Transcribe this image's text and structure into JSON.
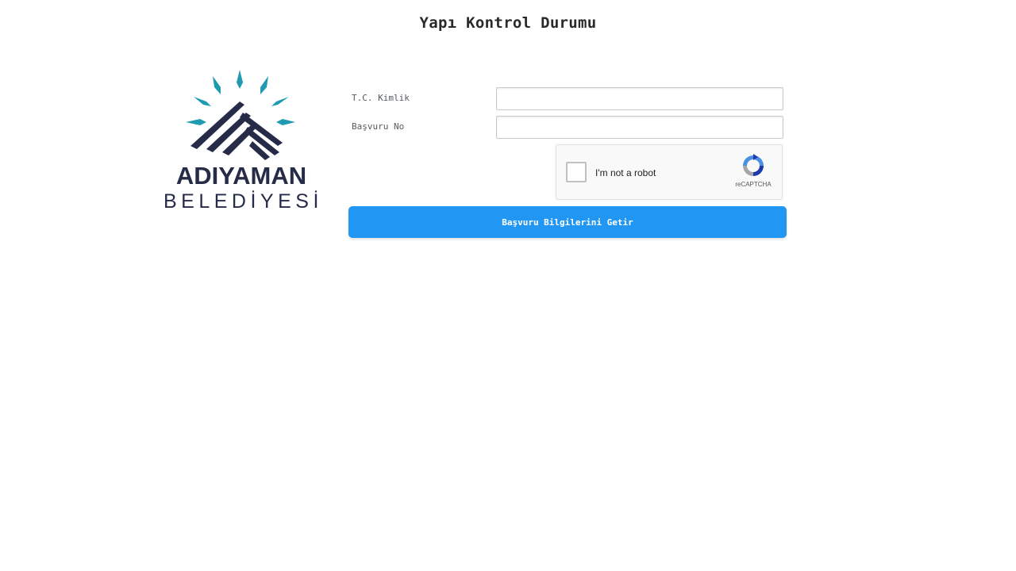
{
  "page": {
    "title": "Yapı Kontrol Durumu"
  },
  "logo": {
    "name": "ADIYAMAN",
    "sub": "BELEDİYESİ",
    "icon": "adiyaman-municipality-logo",
    "colors": {
      "navy": "#262b48",
      "teal": "#1e9bb0"
    }
  },
  "form": {
    "tc_label": "T.C. Kimlik",
    "tc_value": "",
    "basvuru_label": "Başvuru No",
    "basvuru_value": "",
    "submit_label": "Başvuru Bilgilerini Getir"
  },
  "captcha": {
    "text": "I'm not a robot",
    "brand": "reCAPTCHA",
    "checked": false,
    "icon": "recaptcha-icon"
  },
  "colors": {
    "primary_button": "#2196f3",
    "text": "#2a2a2a"
  }
}
